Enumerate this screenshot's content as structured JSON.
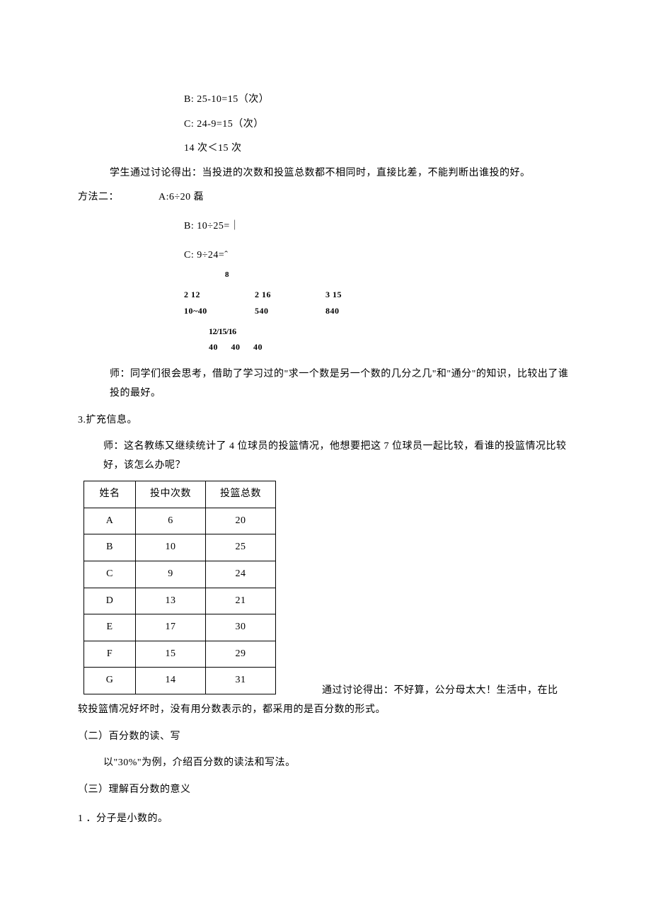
{
  "lines": {
    "b_eq": "B:   25-10=15（次）",
    "c_eq": "C:   24-9=15（次）",
    "cmp": "14 次＜15 次",
    "discuss": "学生通过讨论得出：当投进的次数和投篮总数都不相同时，直接比差，不能判断出谁投的好。",
    "method2_label": "方法二：",
    "method2_a": "A:6÷20 磊",
    "method2_b": "B:   10÷25=｜",
    "method2_c": "C:   9÷24=ˆ",
    "sup8": "8"
  },
  "fracs": {
    "row1_top": [
      "2    12",
      "2   16",
      "3  15"
    ],
    "row1_bot": [
      "10~40",
      "540",
      "840"
    ],
    "final_num": "12/15/16",
    "final_den": [
      "40",
      "40",
      "40"
    ]
  },
  "para1": "师：同学们很会思考，借助了学习过的\"求一个数是另一个数的几分之几\"和\"通分\"的知识，比较出了谁投的最好。",
  "sec3": "3.扩充信息。",
  "para2": "师：这名教练又继续统计了 4 位球员的投篮情况，他想要把这 7 位球员一起比较，看谁的投篮情况比较好，该怎么办呢？",
  "table": {
    "headers": [
      "姓名",
      "投中次数",
      "投篮总数"
    ],
    "rows": [
      [
        "A",
        "6",
        "20"
      ],
      [
        "B",
        "10",
        "25"
      ],
      [
        "C",
        "9",
        "24"
      ],
      [
        "D",
        "13",
        "21"
      ],
      [
        "E",
        "17",
        "30"
      ],
      [
        "F",
        "15",
        "29"
      ],
      [
        "G",
        "14",
        "31"
      ]
    ]
  },
  "after_table": "通过讨论得出：不好算，公分母太大！生活中，在比较投篮情况好坏时，没有用分数表示的，都采用的是百分数的形式。",
  "sec_rw": "（二）百分数的读、写",
  "rw_para": "以\"30%\"为例，介绍百分数的读法和写法。",
  "sec_mean": "（三）理解百分数的意义",
  "item1": "1 ．分子是小数的。"
}
